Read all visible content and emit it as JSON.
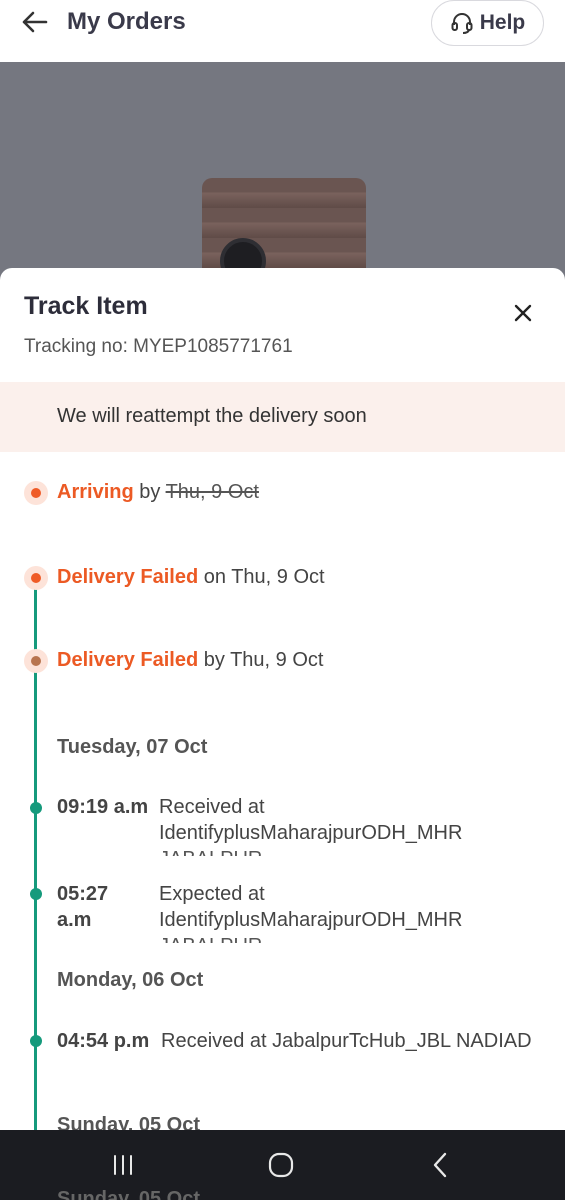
{
  "app_bar": {
    "title": "My Orders",
    "help_label": "Help",
    "back_icon": "arrow-left-icon",
    "help_icon": "headset-icon"
  },
  "sheet": {
    "title": "Track Item",
    "tracking_no": "Tracking no: MYEP1085771761",
    "notice": "We will reattempt the delivery soon",
    "close_icon": "close-icon"
  },
  "timeline": {
    "arriving": {
      "label": "Arriving",
      "prefix": "by",
      "date": "Thu, 9 Oct"
    },
    "failed_1": {
      "label": "Delivery Failed",
      "prefix": "on",
      "date": "Thu, 9 Oct"
    },
    "failed_2": {
      "label": "Delivery Failed",
      "prefix": "by",
      "date": "Thu, 9 Oct"
    },
    "days": [
      {
        "heading": "Tuesday, 07 Oct",
        "events": [
          {
            "time": "09:19 a.m",
            "desc": "Received at",
            "location": "IdentifyplusMaharajpurODH_MHR",
            "location2": "JABALPUR"
          },
          {
            "time": "05:27 a.m",
            "desc": "Expected at",
            "location": "IdentifyplusMaharajpurODH_MHR",
            "location2": "JABALPUR"
          }
        ]
      },
      {
        "heading": "Monday, 06 Oct",
        "events": [
          {
            "time": "04:54 p.m",
            "desc": "Received at JabalpurTcHub_JBL NADIAD"
          }
        ]
      },
      {
        "heading": "Sunday, 05 Oct"
      }
    ]
  },
  "colors": {
    "accent_orange": "#ec5a24",
    "timeline_green": "#159a7c",
    "notice_bg": "#fbf0ec"
  },
  "nav": {
    "recents_icon": "recents-icon",
    "home_icon": "home-icon",
    "back_icon": "nav-back-icon"
  }
}
